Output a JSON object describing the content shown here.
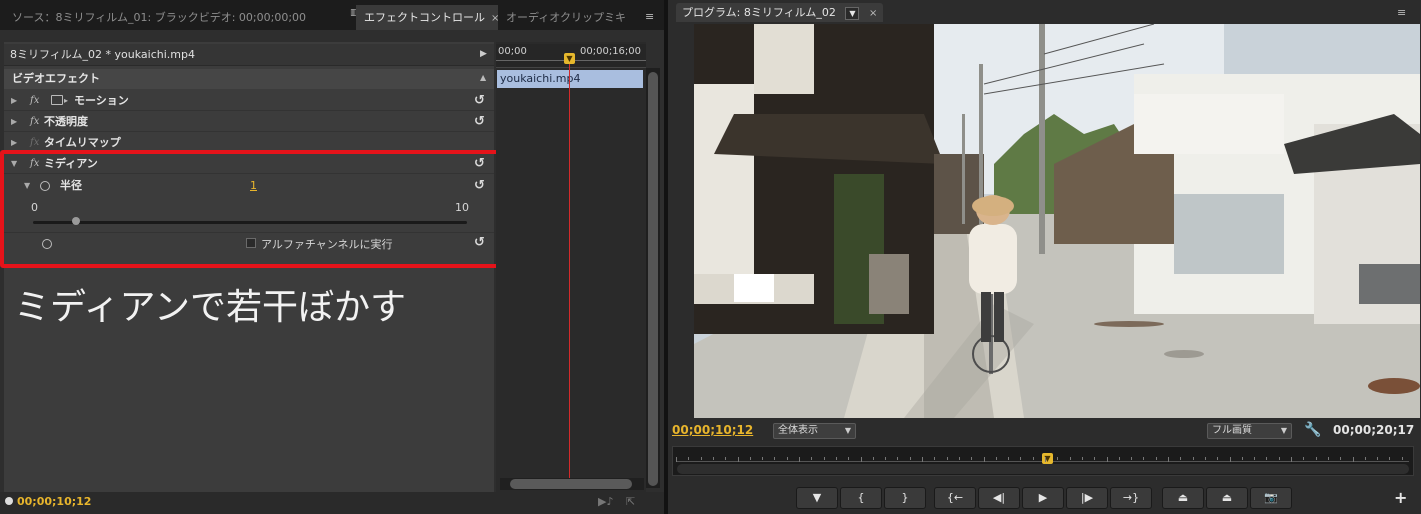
{
  "tabs": {
    "source": "ソース：8ミリフィルム_01: ブラックビデオ: 00;00;00;00",
    "effect_controls": "エフェクトコントロール",
    "audio_mixer": "オーディオクリップミキ",
    "close": "×",
    "menu": "≡"
  },
  "clip_title": "8ミリフィルム_02 * youkaichi.mp4",
  "video_effects_label": "ビデオエフェクト",
  "effects": [
    {
      "name": "モーション"
    },
    {
      "name": "不透明度"
    },
    {
      "name": "タイムリマップ"
    },
    {
      "name": "ミディアン"
    }
  ],
  "median": {
    "radius_label": "半径",
    "radius_value": "1",
    "slider_min": "0",
    "slider_max": "10",
    "slider_fraction": 0.1,
    "alpha_label": "アルファチャンネルに実行"
  },
  "caption": "ミディアンで若干ぼかす",
  "timeline": {
    "start": "00;00",
    "end": "00;00;16;00",
    "clip": "youkaichi.mp4"
  },
  "current_time": "00;00;10;12",
  "program": {
    "tab_label": "プログラム: 8ミリフィルム_02",
    "current_time": "00;00;10;12",
    "zoom": "全体表示",
    "quality": "フル画質",
    "duration": "00;00;20;17",
    "add": "+"
  },
  "colors": {
    "accent": "#e8b52c",
    "highlight": "#e5131a",
    "clip": "#a9bedf"
  }
}
